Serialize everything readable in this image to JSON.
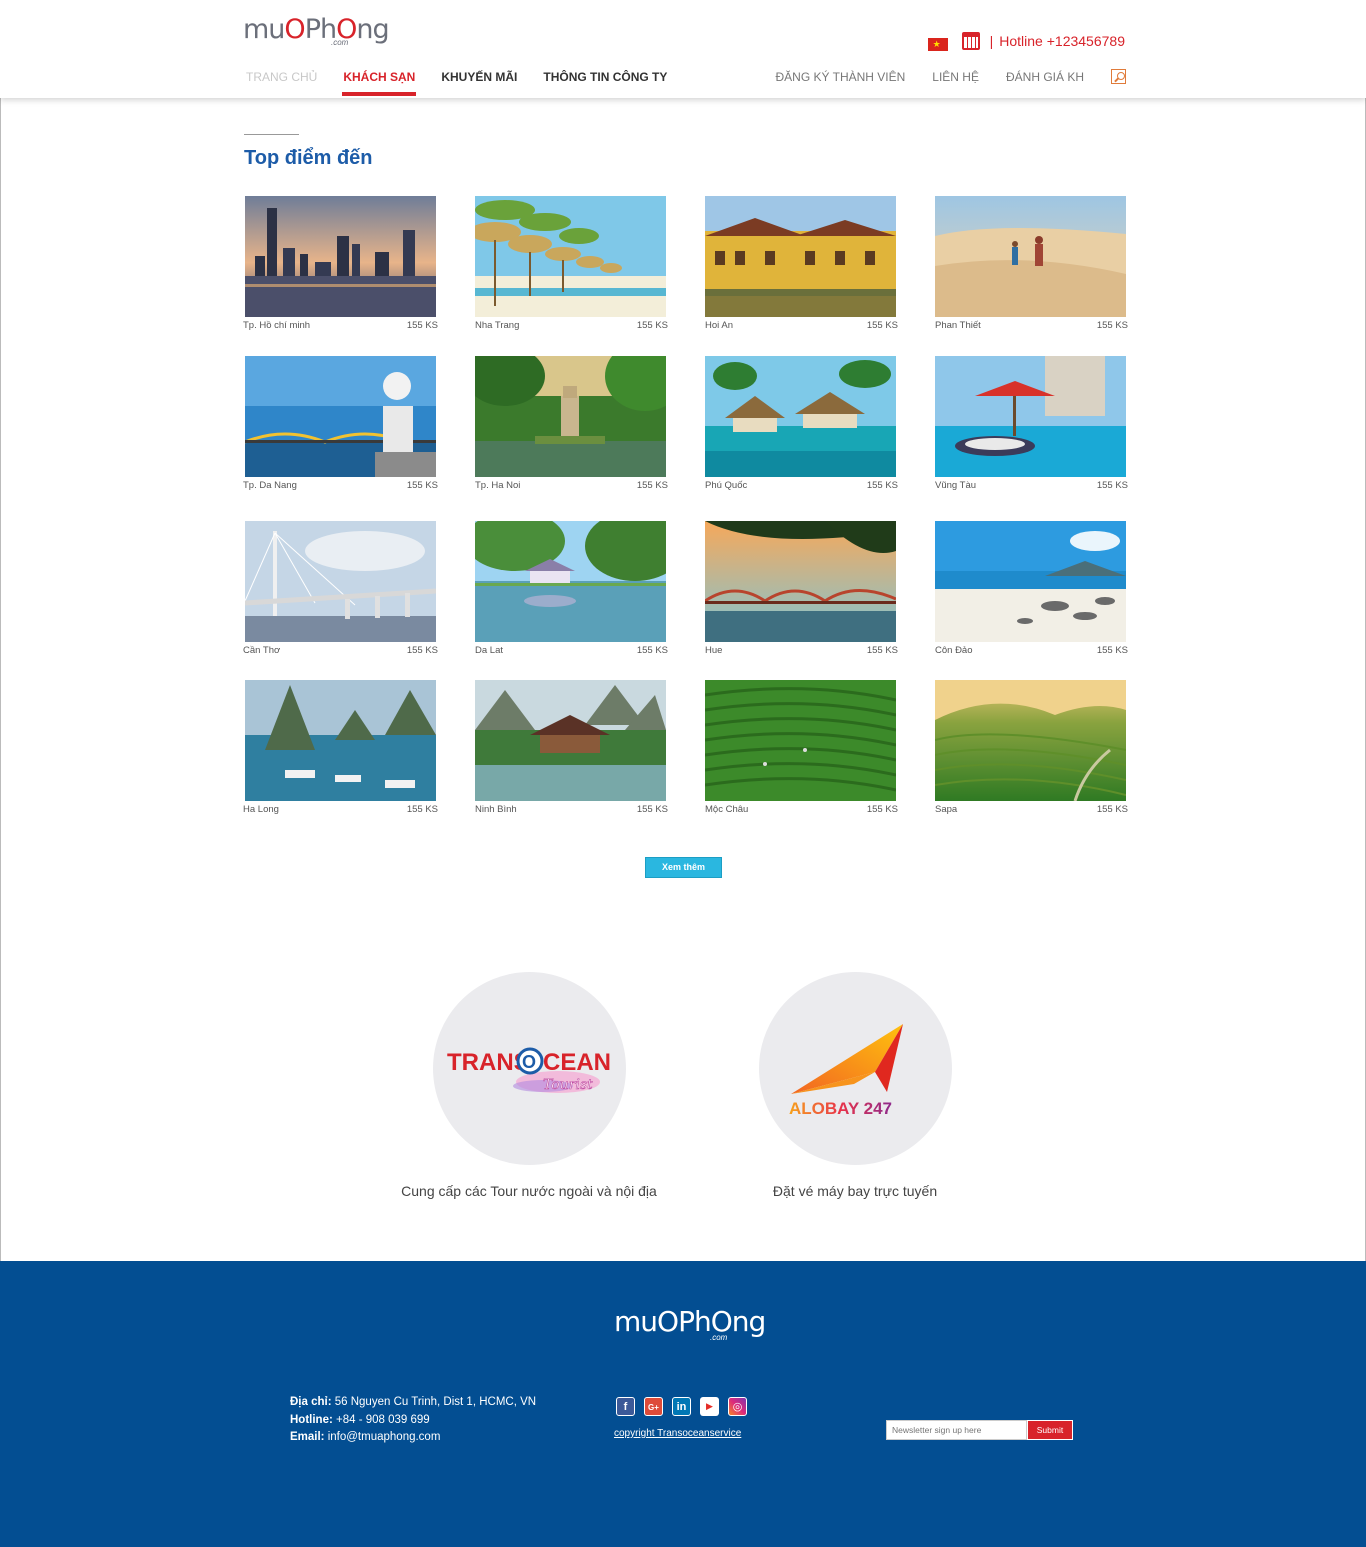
{
  "brand": {
    "logo_part1": "mu",
    "logo_part2": "P",
    "logo_part3": "h",
    "logo_part4": "ng",
    "logo_dotcom": ".com",
    "logo_text": "muaPhong"
  },
  "topbar": {
    "separator": "|",
    "hotline": "Hotline +123456789",
    "flag": "vietnam-flag-icon",
    "calendar": "calendar-icon"
  },
  "nav": {
    "left": [
      {
        "label": "TRANG CHỦ"
      },
      {
        "label": "KHÁCH SẠN"
      },
      {
        "label": "KHUYẾN MÃI"
      },
      {
        "label": "THÔNG TIN CÔNG TY"
      }
    ],
    "right": [
      {
        "label": "ĐĂNG KÝ THÀNH VIÊN"
      },
      {
        "label": "LIÊN HỆ"
      },
      {
        "label": "ĐÁNH GIÁ KH"
      }
    ]
  },
  "section": {
    "title": "Top điểm đến"
  },
  "destinations": [
    {
      "name": "Tp. Hồ chí minh",
      "count": "155 KS"
    },
    {
      "name": "Nha Trang",
      "count": "155 KS"
    },
    {
      "name": "Hoi An",
      "count": "155 KS"
    },
    {
      "name": "Phan Thiết",
      "count": "155 KS"
    },
    {
      "name": "Tp. Da Nang",
      "count": "155 KS"
    },
    {
      "name": "Tp. Ha Noi",
      "count": "155 KS"
    },
    {
      "name": "Phú Quốc",
      "count": "155 KS"
    },
    {
      "name": "Vũng Tàu",
      "count": "155 KS"
    },
    {
      "name": "Cần Thơ",
      "count": "155 KS"
    },
    {
      "name": "Da Lat",
      "count": "155 KS"
    },
    {
      "name": "Hue",
      "count": "155 KS"
    },
    {
      "name": "Côn Đảo",
      "count": "155 KS"
    },
    {
      "name": "Ha Long",
      "count": "155 KS"
    },
    {
      "name": "Ninh Bình",
      "count": "155 KS"
    },
    {
      "name": "Mộc Châu",
      "count": "155 KS"
    },
    {
      "name": "Sapa",
      "count": "155 KS"
    }
  ],
  "more_button": "Xem thêm",
  "partners": [
    {
      "logo_main": "TRANS",
      "logo_o": "O",
      "logo_rest": "CEAN",
      "logo_sub": "Tourist",
      "caption": "Cung cấp các Tour nước ngoài và nội địa"
    },
    {
      "logo_main": "ALOBAY 247",
      "caption": "Đặt vé máy bay trực tuyến"
    }
  ],
  "footer": {
    "address_label": "Địa chỉ:",
    "address": "56 Nguyen Cu Trinh, Dist 1, HCMC, VN",
    "hotline_label": "Hotline:",
    "hotline": "+84 - 908 039 699",
    "email_label": "Email:",
    "email": "info@tmuaphong.com",
    "copyright": "copyright Transoceanservice",
    "newsletter_placeholder": "Newsletter sign up here",
    "submit": "Submit",
    "socials": [
      {
        "icon": "facebook-icon",
        "glyph": "f"
      },
      {
        "icon": "google-plus-icon",
        "glyph": "G+"
      },
      {
        "icon": "linkedin-icon",
        "glyph": "in"
      },
      {
        "icon": "youtube-icon",
        "glyph": "▶"
      },
      {
        "icon": "instagram-icon",
        "glyph": "◎"
      }
    ]
  },
  "colors": {
    "brand_red": "#d8232a",
    "brand_blue": "#1d5ca8",
    "footer_blue": "#034e92",
    "button_cyan": "#2ab7e0"
  }
}
